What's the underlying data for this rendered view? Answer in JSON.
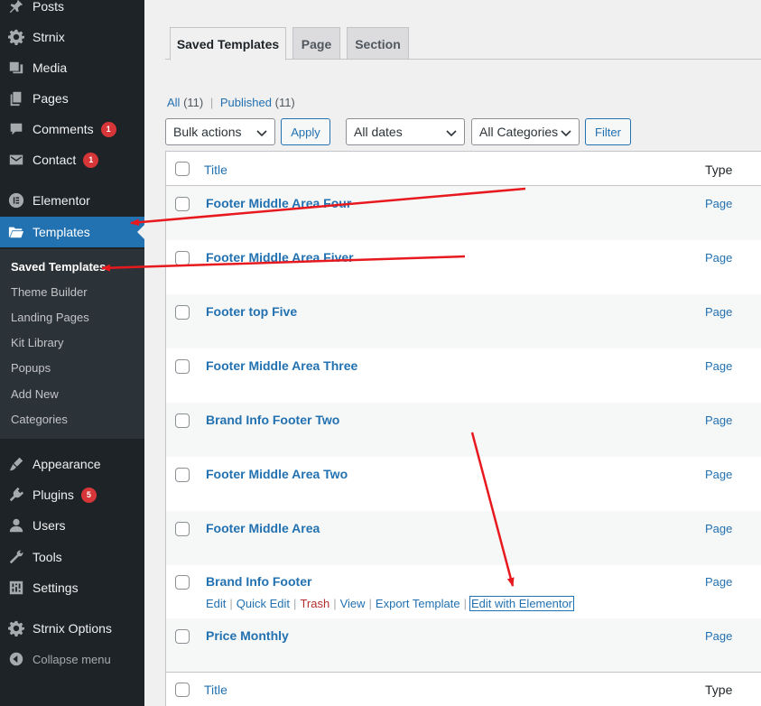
{
  "sidebar": {
    "items": [
      {
        "label": "Posts",
        "icon": "pin-icon"
      },
      {
        "label": "Strnix",
        "icon": "gear-icon"
      },
      {
        "label": "Media",
        "icon": "media-icon"
      },
      {
        "label": "Pages",
        "icon": "pages-icon"
      },
      {
        "label": "Comments",
        "icon": "comment-icon",
        "badge": "1"
      },
      {
        "label": "Contact",
        "icon": "mail-icon",
        "badge": "1"
      },
      {
        "label": "Elementor",
        "icon": "elementor-icon"
      },
      {
        "label": "Templates",
        "icon": "folder-icon"
      },
      {
        "label": "Appearance",
        "icon": "brush-icon"
      },
      {
        "label": "Plugins",
        "icon": "plugin-icon",
        "badge": "5"
      },
      {
        "label": "Users",
        "icon": "user-icon"
      },
      {
        "label": "Tools",
        "icon": "wrench-icon"
      },
      {
        "label": "Settings",
        "icon": "settings-icon"
      },
      {
        "label": "Strnix Options",
        "icon": "gear-icon"
      }
    ],
    "submenu": [
      "Saved Templates",
      "Theme Builder",
      "Landing Pages",
      "Kit Library",
      "Popups",
      "Add New",
      "Categories"
    ],
    "collapse_label": "Collapse menu"
  },
  "tabs": [
    "Saved Templates",
    "Page",
    "Section"
  ],
  "filters": {
    "all_label": "All",
    "all_count": "(11)",
    "separator": "|",
    "published_label": "Published",
    "published_count": "(11)"
  },
  "controls": {
    "bulk_actions": "Bulk actions",
    "apply": "Apply",
    "dates": "All dates",
    "categories": "All Categories",
    "filter": "Filter"
  },
  "table": {
    "headers": {
      "title": "Title",
      "type": "Type"
    },
    "rows": [
      {
        "title": "Footer Middle Area Four",
        "type": "Page"
      },
      {
        "title": "Footer Middle Area Fiver",
        "type": "Page"
      },
      {
        "title": "Footer top Five",
        "type": "Page"
      },
      {
        "title": "Footer Middle Area Three",
        "type": "Page"
      },
      {
        "title": "Brand Info Footer Two",
        "type": "Page"
      },
      {
        "title": "Footer Middle Area Two",
        "type": "Page"
      },
      {
        "title": "Footer Middle Area",
        "type": "Page"
      },
      {
        "title": "Brand Info Footer",
        "type": "Page"
      },
      {
        "title": "Price Monthly",
        "type": "Page"
      }
    ],
    "row_actions": [
      "Edit",
      "Quick Edit",
      "Trash",
      "View",
      "Export Template",
      "Edit with Elementor"
    ]
  },
  "colors": {
    "sidebar_bg": "#1d2327",
    "accent": "#2271b1",
    "badge": "#d63638",
    "annotation_arrow": "#e8191e"
  }
}
